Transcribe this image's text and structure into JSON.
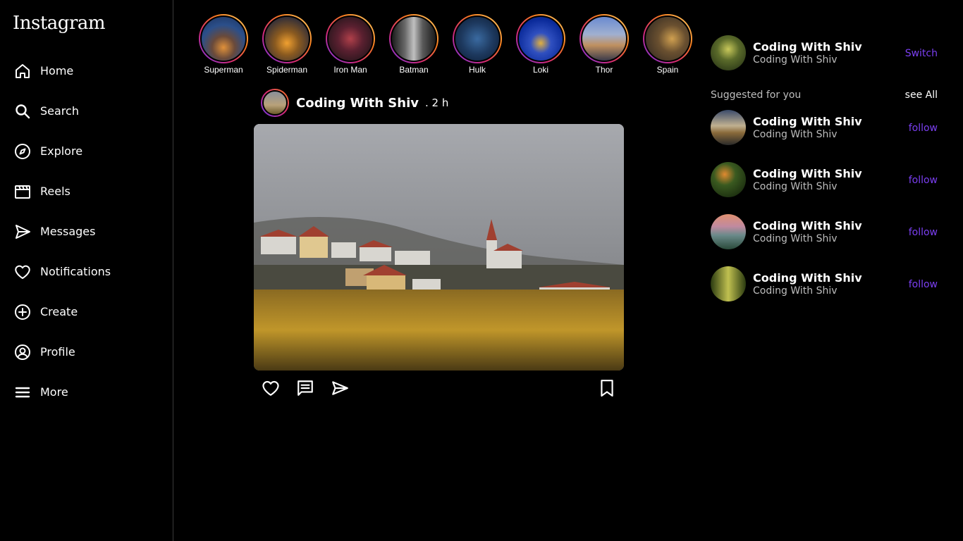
{
  "app": {
    "title": "Instagram"
  },
  "sidebar": {
    "items": [
      {
        "label": "Home",
        "icon": "home-icon"
      },
      {
        "label": "Search",
        "icon": "search-icon"
      },
      {
        "label": "Explore",
        "icon": "compass-icon"
      },
      {
        "label": "Reels",
        "icon": "reels-icon"
      },
      {
        "label": "Messages",
        "icon": "send-icon"
      },
      {
        "label": "Notifications",
        "icon": "heart-icon"
      },
      {
        "label": "Create",
        "icon": "plus-circle-icon"
      },
      {
        "label": "Profile",
        "icon": "user-circle-icon"
      },
      {
        "label": "More",
        "icon": "menu-icon"
      }
    ]
  },
  "stories": [
    {
      "name": "Superman"
    },
    {
      "name": "Spiderman"
    },
    {
      "name": "Iron Man"
    },
    {
      "name": "Batman"
    },
    {
      "name": "Hulk"
    },
    {
      "name": "Loki"
    },
    {
      "name": "Thor"
    },
    {
      "name": "Spain"
    }
  ],
  "post": {
    "username": "Coding With Shiv",
    "time": ". 2 h",
    "icons": [
      "heart-icon",
      "comment-icon",
      "send-icon",
      "bookmark-icon"
    ]
  },
  "current_user": {
    "title": "Coding With Shiv",
    "subtitle": "Coding With Shiv",
    "action": "Switch"
  },
  "suggestions": {
    "heading": "Suggested for you",
    "see_all": "see All",
    "items": [
      {
        "title": "Coding With Shiv",
        "subtitle": "Coding With Shiv",
        "action": "follow"
      },
      {
        "title": "Coding With Shiv",
        "subtitle": "Coding With Shiv",
        "action": "follow"
      },
      {
        "title": "Coding With Shiv",
        "subtitle": "Coding With Shiv",
        "action": "follow"
      },
      {
        "title": "Coding With Shiv",
        "subtitle": "Coding With Shiv",
        "action": "follow"
      }
    ]
  },
  "colors": {
    "background": "#000000",
    "accent": "#7b3ff2",
    "story_ring": [
      "#6b3bf0",
      "#d62976",
      "#fa7e1e"
    ]
  }
}
